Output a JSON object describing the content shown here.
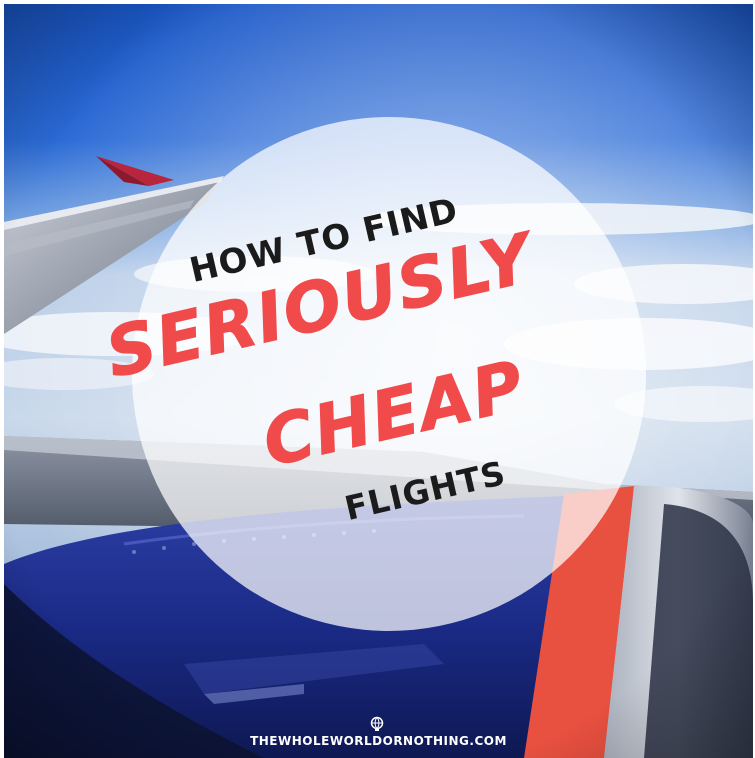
{
  "pin": {
    "line1": "HOW TO FIND",
    "line2": "SERIOUSLY",
    "line3": "CHEAP",
    "line4": "FLIGHTS"
  },
  "footer": {
    "site": "THEWHOLEWORLDORNOTHING.COM",
    "icon": "globe-icon"
  },
  "colors": {
    "accent_red": "#f04a4a",
    "title_dark": "#1b1b1b",
    "sky_blue": "#1e5fcf",
    "engine_blue": "#1a2e8c"
  }
}
